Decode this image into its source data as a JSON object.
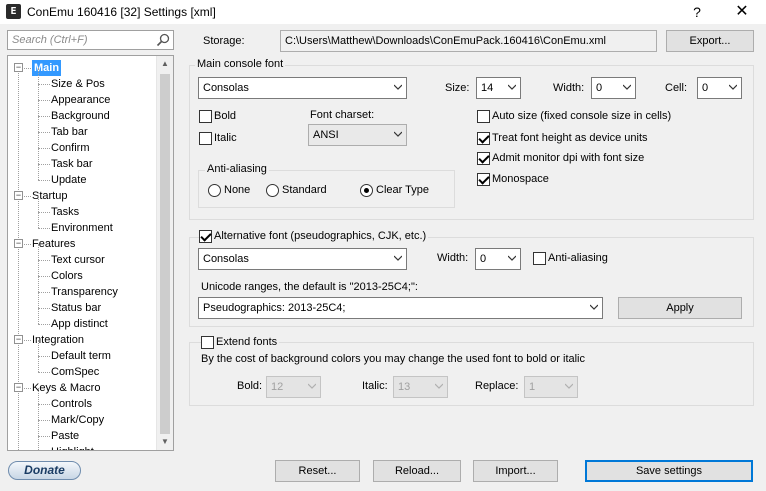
{
  "window": {
    "title": "ConEmu 160416 [32] Settings [xml]",
    "help_label": "?",
    "close_label": "✕"
  },
  "search": {
    "placeholder": "Search (Ctrl+F)"
  },
  "storage": {
    "label": "Storage:",
    "path": "C:\\Users\\Matthew\\Downloads\\ConEmuPack.160416\\ConEmu.xml",
    "export_label": "Export..."
  },
  "tree": [
    {
      "label": "Main",
      "level": 0,
      "selected": true,
      "expander": "-"
    },
    {
      "label": "Size & Pos",
      "level": 1
    },
    {
      "label": "Appearance",
      "level": 1
    },
    {
      "label": "Background",
      "level": 1
    },
    {
      "label": "Tab bar",
      "level": 1
    },
    {
      "label": "Confirm",
      "level": 1
    },
    {
      "label": "Task bar",
      "level": 1
    },
    {
      "label": "Update",
      "level": 1
    },
    {
      "label": "Startup",
      "level": 0,
      "expander": "-"
    },
    {
      "label": "Tasks",
      "level": 1
    },
    {
      "label": "Environment",
      "level": 1
    },
    {
      "label": "Features",
      "level": 0,
      "expander": "-"
    },
    {
      "label": "Text cursor",
      "level": 1
    },
    {
      "label": "Colors",
      "level": 1
    },
    {
      "label": "Transparency",
      "level": 1
    },
    {
      "label": "Status bar",
      "level": 1
    },
    {
      "label": "App distinct",
      "level": 1
    },
    {
      "label": "Integration",
      "level": 0,
      "expander": "-"
    },
    {
      "label": "Default term",
      "level": 1
    },
    {
      "label": "ComSpec",
      "level": 1
    },
    {
      "label": "Keys & Macro",
      "level": 0,
      "expander": "-"
    },
    {
      "label": "Controls",
      "level": 1
    },
    {
      "label": "Mark/Copy",
      "level": 1
    },
    {
      "label": "Paste",
      "level": 1
    },
    {
      "label": "Highlight",
      "level": 1
    }
  ],
  "main_font": {
    "group_title": "Main console font",
    "font_name": "Consolas",
    "size_label": "Size:",
    "size_value": "14",
    "width_label": "Width:",
    "width_value": "0",
    "cell_label": "Cell:",
    "cell_value": "0",
    "bold_label": "Bold",
    "bold_checked": false,
    "italic_label": "Italic",
    "italic_checked": false,
    "charset_label": "Font charset:",
    "charset_value": "ANSI",
    "auto_size_label": "Auto size (fixed console size in cells)",
    "auto_size_checked": false,
    "treat_height_label": "Treat font height as device units",
    "treat_height_checked": true,
    "admit_dpi_label": "Admit monitor dpi with font size",
    "admit_dpi_checked": true,
    "monospace_label": "Monospace",
    "monospace_checked": true,
    "antialias_title": "Anti-aliasing",
    "aa_none": "None",
    "aa_standard": "Standard",
    "aa_cleartype": "Clear Type",
    "aa_selected": "cleartype"
  },
  "alt_font": {
    "checkbox_label": "Alternative font (pseudographics, CJK, etc.)",
    "checked": true,
    "font_name": "Consolas",
    "width_label": "Width:",
    "width_value": "0",
    "antialias_label": "Anti-aliasing",
    "antialias_checked": false,
    "unicode_label": "Unicode ranges, the default is \"2013-25C4;\":",
    "unicode_value": "Pseudographics: 2013-25C4;",
    "apply_label": "Apply"
  },
  "extend_fonts": {
    "checkbox_label": "Extend fonts",
    "checked": false,
    "description": "By the cost of background colors you may change the used font to bold or italic",
    "bold_label": "Bold:",
    "bold_value": "12",
    "italic_label": "Italic:",
    "italic_value": "13",
    "replace_label": "Replace:",
    "replace_value": "1"
  },
  "footer": {
    "donate_label": "Donate",
    "reset_label": "Reset...",
    "reload_label": "Reload...",
    "import_label": "Import...",
    "save_label": "Save settings"
  }
}
